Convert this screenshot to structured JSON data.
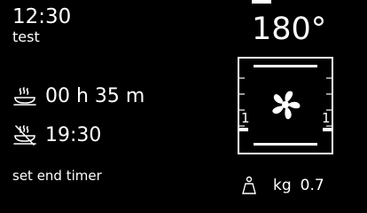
{
  "clock": {
    "time": "12:30",
    "label": "test"
  },
  "temperature": {
    "value": "180°"
  },
  "cooking": {
    "duration": "00 h 35 m",
    "end_time": "19:30"
  },
  "actions": {
    "set_end_timer": "set end timer"
  },
  "oven": {
    "left_level": "1",
    "right_level": "1"
  },
  "weight": {
    "unit": "kg",
    "value": "0.7"
  },
  "colors": {
    "background": "#000000",
    "foreground": "#ffffff"
  },
  "icons": {
    "duration": "steam-dish-icon",
    "end_time": "end-timer-icon",
    "fan": "convection-fan-icon",
    "weight": "weight-icon"
  }
}
